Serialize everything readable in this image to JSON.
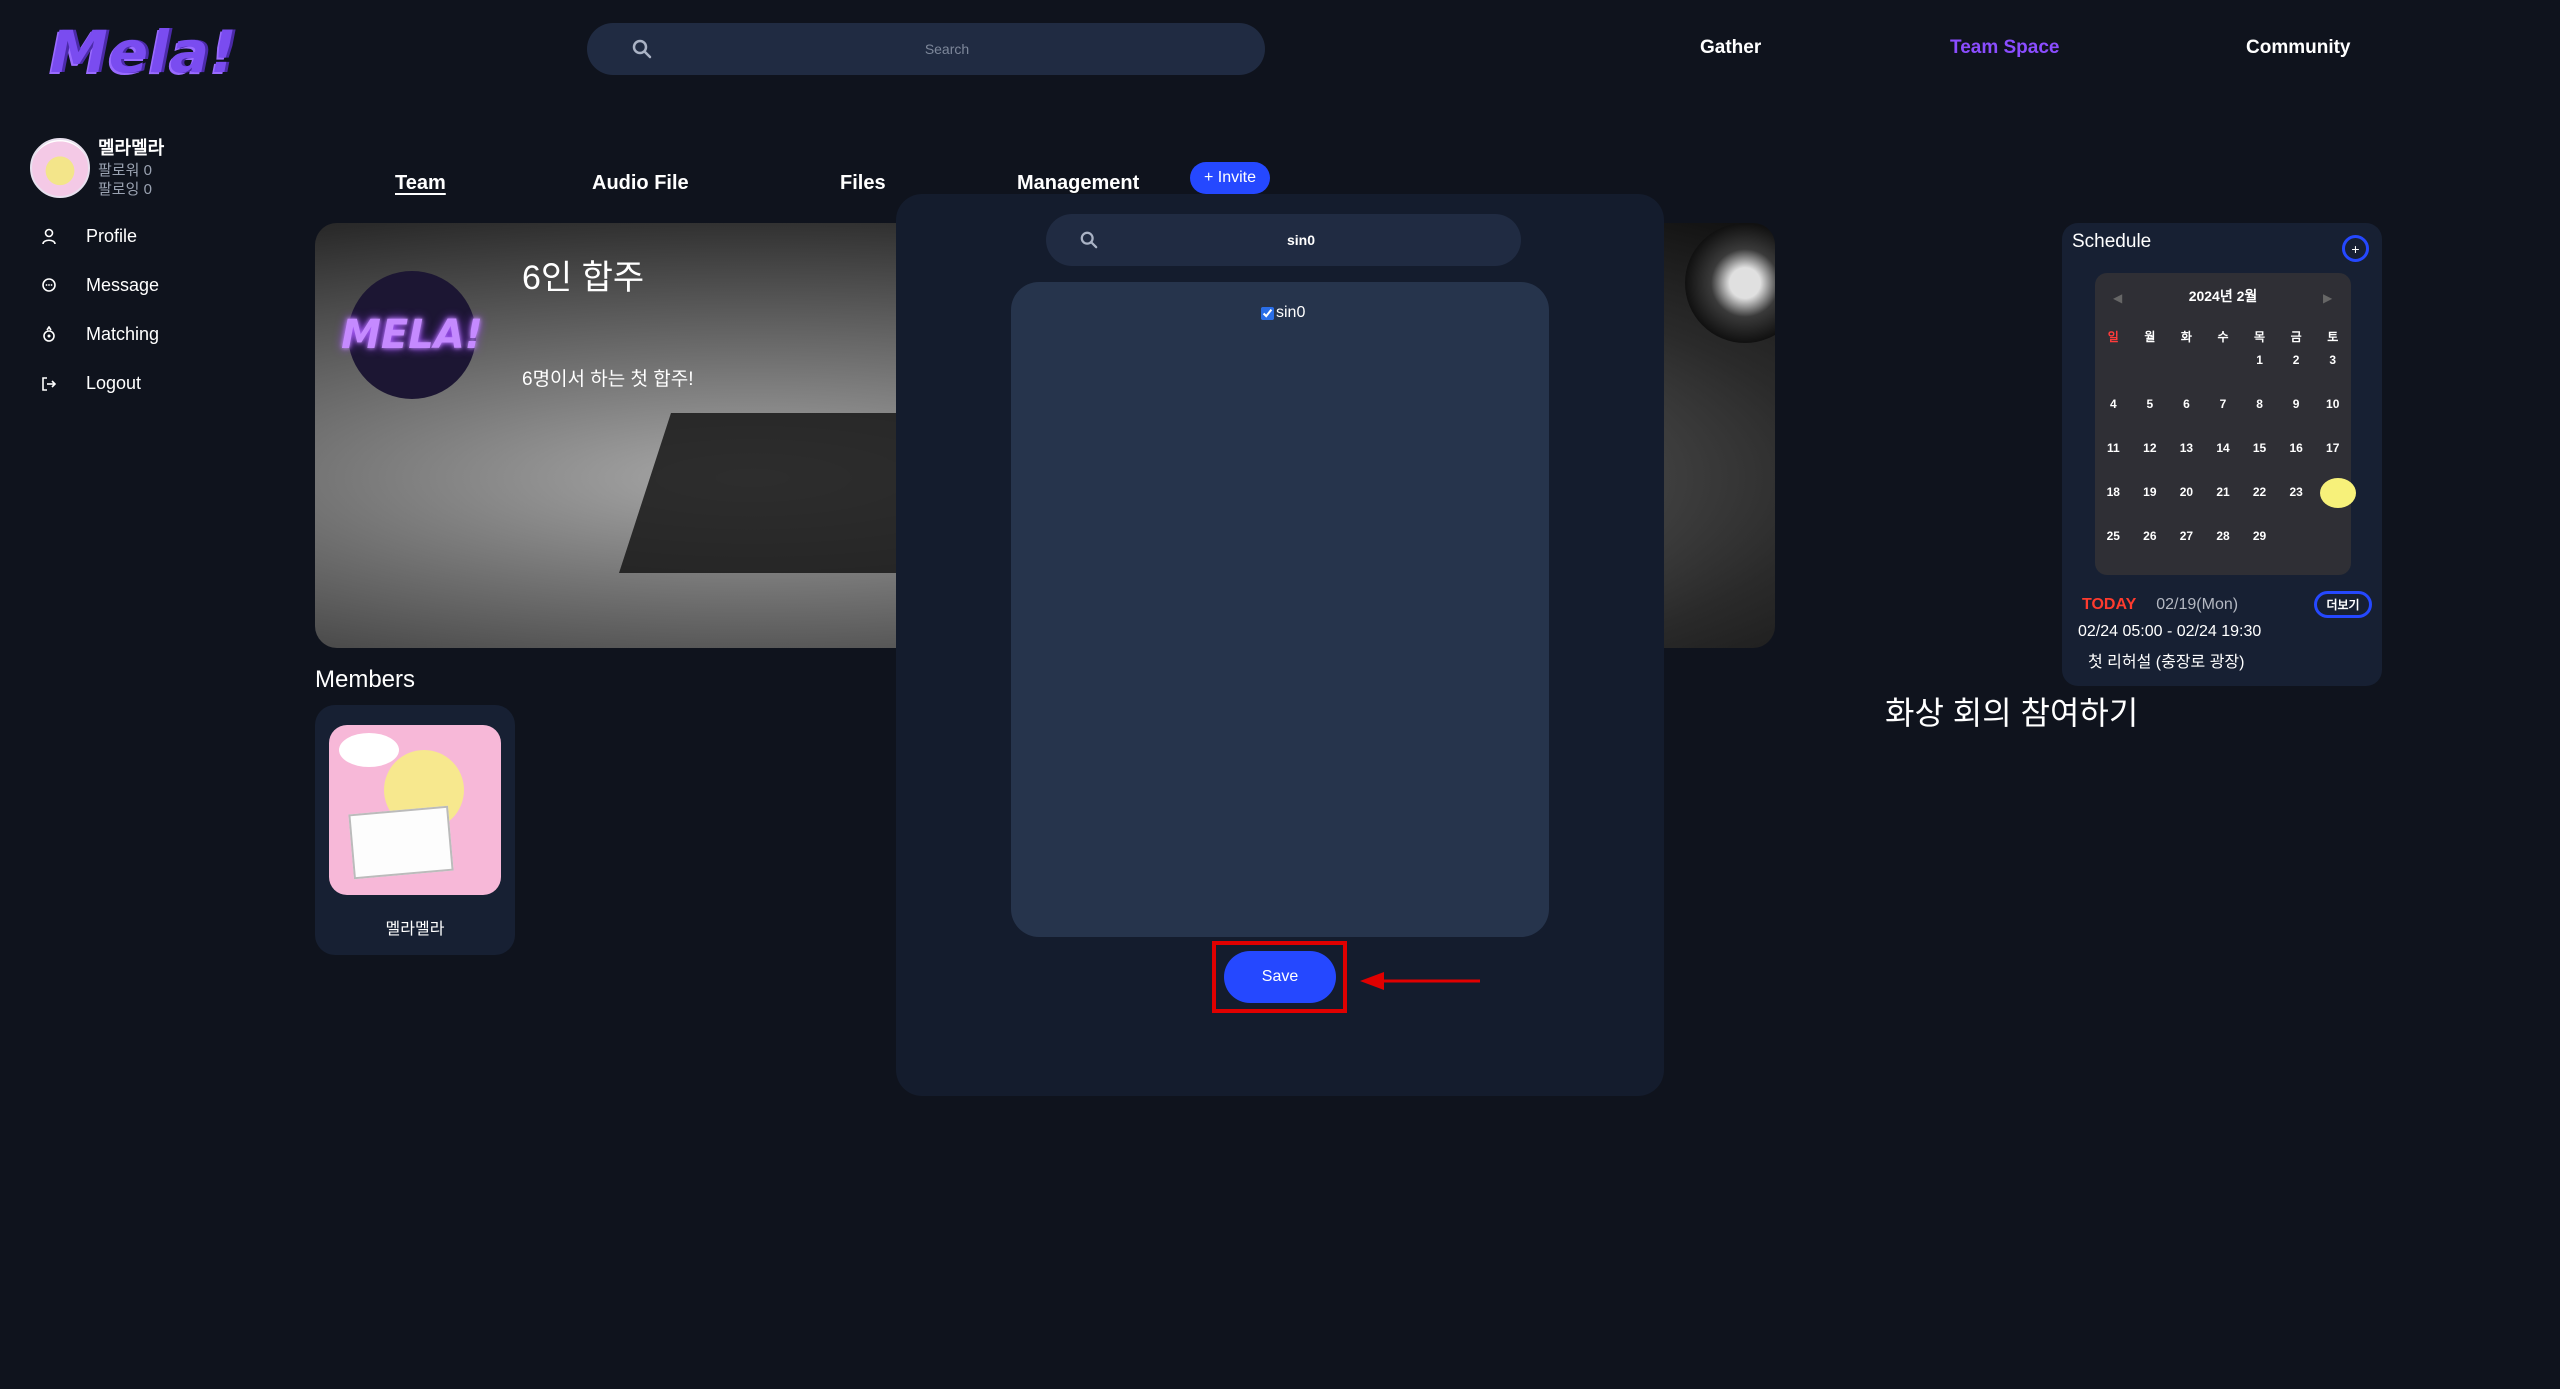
{
  "app": {
    "logo": "Mela!"
  },
  "search": {
    "placeholder": "Search"
  },
  "topnav": {
    "gather": "Gather",
    "team_space": "Team Space",
    "community": "Community",
    "active_color": "#8b4dff"
  },
  "user": {
    "name": "멜라멜라",
    "followers": "팔로워 0",
    "following": "팔로잉 0"
  },
  "sidebar": {
    "items": [
      {
        "label": "Profile",
        "icon": "user-icon"
      },
      {
        "label": "Message",
        "icon": "message-icon"
      },
      {
        "label": "Matching",
        "icon": "matching-icon"
      },
      {
        "label": "Logout",
        "icon": "logout-icon"
      }
    ]
  },
  "tabs": {
    "team": "Team",
    "audio": "Audio File",
    "files": "Files",
    "management": "Management",
    "invite": "+ Invite"
  },
  "team": {
    "logo_text": "MELA!",
    "title": "6인 합주",
    "description": "6명이서 하는 첫 합주!"
  },
  "members": {
    "heading": "Members",
    "list": [
      {
        "name": "멜라멜라"
      }
    ]
  },
  "modal": {
    "search_value": "sin0",
    "results": [
      {
        "label": "sin0",
        "checked": true
      }
    ],
    "save_label": "Save"
  },
  "schedule": {
    "title": "Schedule",
    "add_label": "+",
    "month": "2024년 2월",
    "weekdays": [
      "일",
      "월",
      "화",
      "수",
      "목",
      "금",
      "토"
    ],
    "first_weekday_index": 4,
    "days_in_month": 29,
    "today_day": 24,
    "today_label": "TODAY",
    "today_date": "02/19(Mon)",
    "more_label": "더보기",
    "event_time": "02/24 05:00 - 02/24 19:30",
    "event_title": "첫 리허설 (충장로 광장)"
  },
  "video_meeting": "화상 회의 참여하기",
  "colors": {
    "background": "#0f131d",
    "accent": "#2548ff",
    "highlight": "#e00000",
    "today": "#ff3b2e"
  }
}
